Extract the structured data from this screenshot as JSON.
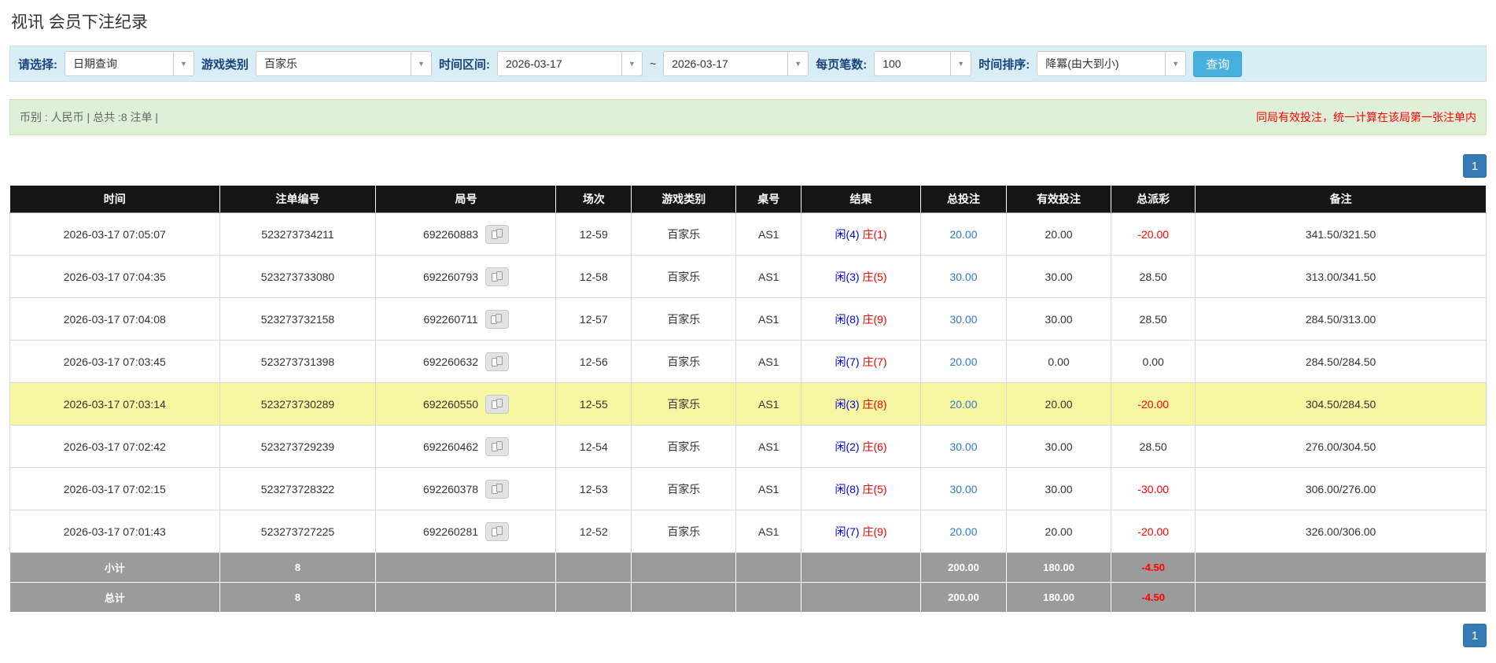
{
  "page_title": "视讯 会员下注纪录",
  "colors": {
    "filter-bg": "#d9edf7",
    "info-bg": "#dff0d8",
    "accent-blue": "#337ab7",
    "search-btn": "#48b0dd",
    "link-blue": "#2e7bcc",
    "player-blue": "#0000ee",
    "banker-red": "#ee0000",
    "negative-red": "#ff0000",
    "header-bg": "#151515",
    "footer-bg": "#9b9b9b",
    "highlight-yellow": "#f7f7a1"
  },
  "filters": {
    "select_label": "请选择:",
    "select_value": "日期查询",
    "game_type_label": "游戏类别",
    "game_type_value": "百家乐",
    "time_range_label": "时间区间:",
    "date_from": "2026-03-17",
    "date_separator": "~",
    "date_to": "2026-03-17",
    "page_size_label": "每页笔数:",
    "page_size_value": "100",
    "sort_label": "时间排序:",
    "sort_value": "降冪(由大到小)",
    "search_button": "查询"
  },
  "info_bar": {
    "summary": "币别 : 人民币 | 总共 :8 注单 |",
    "notice": "同局有效投注，统一计算在该局第一张注单内"
  },
  "pagination": {
    "page": "1"
  },
  "table": {
    "headers": [
      "时间",
      "注单编号",
      "局号",
      "场次",
      "游戏类别",
      "桌号",
      "结果",
      "总投注",
      "有效投注",
      "总派彩",
      "备注"
    ],
    "rows": [
      {
        "time": "2026-03-17 07:05:07",
        "bet_id": "523273734211",
        "round": "692260883",
        "session": "12-59",
        "game": "百家乐",
        "table_no": "AS1",
        "result_player": "闲(4)",
        "result_banker": "庄(1)",
        "total_bet": "20.00",
        "valid_bet": "20.00",
        "payout": "-20.00",
        "remark": "341.50/321.50",
        "highlight": false
      },
      {
        "time": "2026-03-17 07:04:35",
        "bet_id": "523273733080",
        "round": "692260793",
        "session": "12-58",
        "game": "百家乐",
        "table_no": "AS1",
        "result_player": "闲(3)",
        "result_banker": "庄(5)",
        "total_bet": "30.00",
        "valid_bet": "30.00",
        "payout": "28.50",
        "remark": "313.00/341.50",
        "highlight": false
      },
      {
        "time": "2026-03-17 07:04:08",
        "bet_id": "523273732158",
        "round": "692260711",
        "session": "12-57",
        "game": "百家乐",
        "table_no": "AS1",
        "result_player": "闲(8)",
        "result_banker": "庄(9)",
        "total_bet": "30.00",
        "valid_bet": "30.00",
        "payout": "28.50",
        "remark": "284.50/313.00",
        "highlight": false
      },
      {
        "time": "2026-03-17 07:03:45",
        "bet_id": "523273731398",
        "round": "692260632",
        "session": "12-56",
        "game": "百家乐",
        "table_no": "AS1",
        "result_player": "闲(7)",
        "result_banker": "庄(7)",
        "total_bet": "20.00",
        "valid_bet": "0.00",
        "payout": "0.00",
        "remark": "284.50/284.50",
        "highlight": false
      },
      {
        "time": "2026-03-17 07:03:14",
        "bet_id": "523273730289",
        "round": "692260550",
        "session": "12-55",
        "game": "百家乐",
        "table_no": "AS1",
        "result_player": "闲(3)",
        "result_banker": "庄(8)",
        "total_bet": "20.00",
        "valid_bet": "20.00",
        "payout": "-20.00",
        "remark": "304.50/284.50",
        "highlight": true
      },
      {
        "time": "2026-03-17 07:02:42",
        "bet_id": "523273729239",
        "round": "692260462",
        "session": "12-54",
        "game": "百家乐",
        "table_no": "AS1",
        "result_player": "闲(2)",
        "result_banker": "庄(6)",
        "total_bet": "30.00",
        "valid_bet": "30.00",
        "payout": "28.50",
        "remark": "276.00/304.50",
        "highlight": false
      },
      {
        "time": "2026-03-17 07:02:15",
        "bet_id": "523273728322",
        "round": "692260378",
        "session": "12-53",
        "game": "百家乐",
        "table_no": "AS1",
        "result_player": "闲(8)",
        "result_banker": "庄(5)",
        "total_bet": "30.00",
        "valid_bet": "30.00",
        "payout": "-30.00",
        "remark": "306.00/276.00",
        "highlight": false
      },
      {
        "time": "2026-03-17 07:01:43",
        "bet_id": "523273727225",
        "round": "692260281",
        "session": "12-52",
        "game": "百家乐",
        "table_no": "AS1",
        "result_player": "闲(7)",
        "result_banker": "庄(9)",
        "total_bet": "20.00",
        "valid_bet": "20.00",
        "payout": "-20.00",
        "remark": "326.00/306.00",
        "highlight": false
      }
    ],
    "subtotal": {
      "label": "小计",
      "count": "8",
      "total_bet": "200.00",
      "valid_bet": "180.00",
      "payout": "-4.50"
    },
    "total": {
      "label": "总计",
      "count": "8",
      "total_bet": "200.00",
      "valid_bet": "180.00",
      "payout": "-4.50"
    }
  }
}
